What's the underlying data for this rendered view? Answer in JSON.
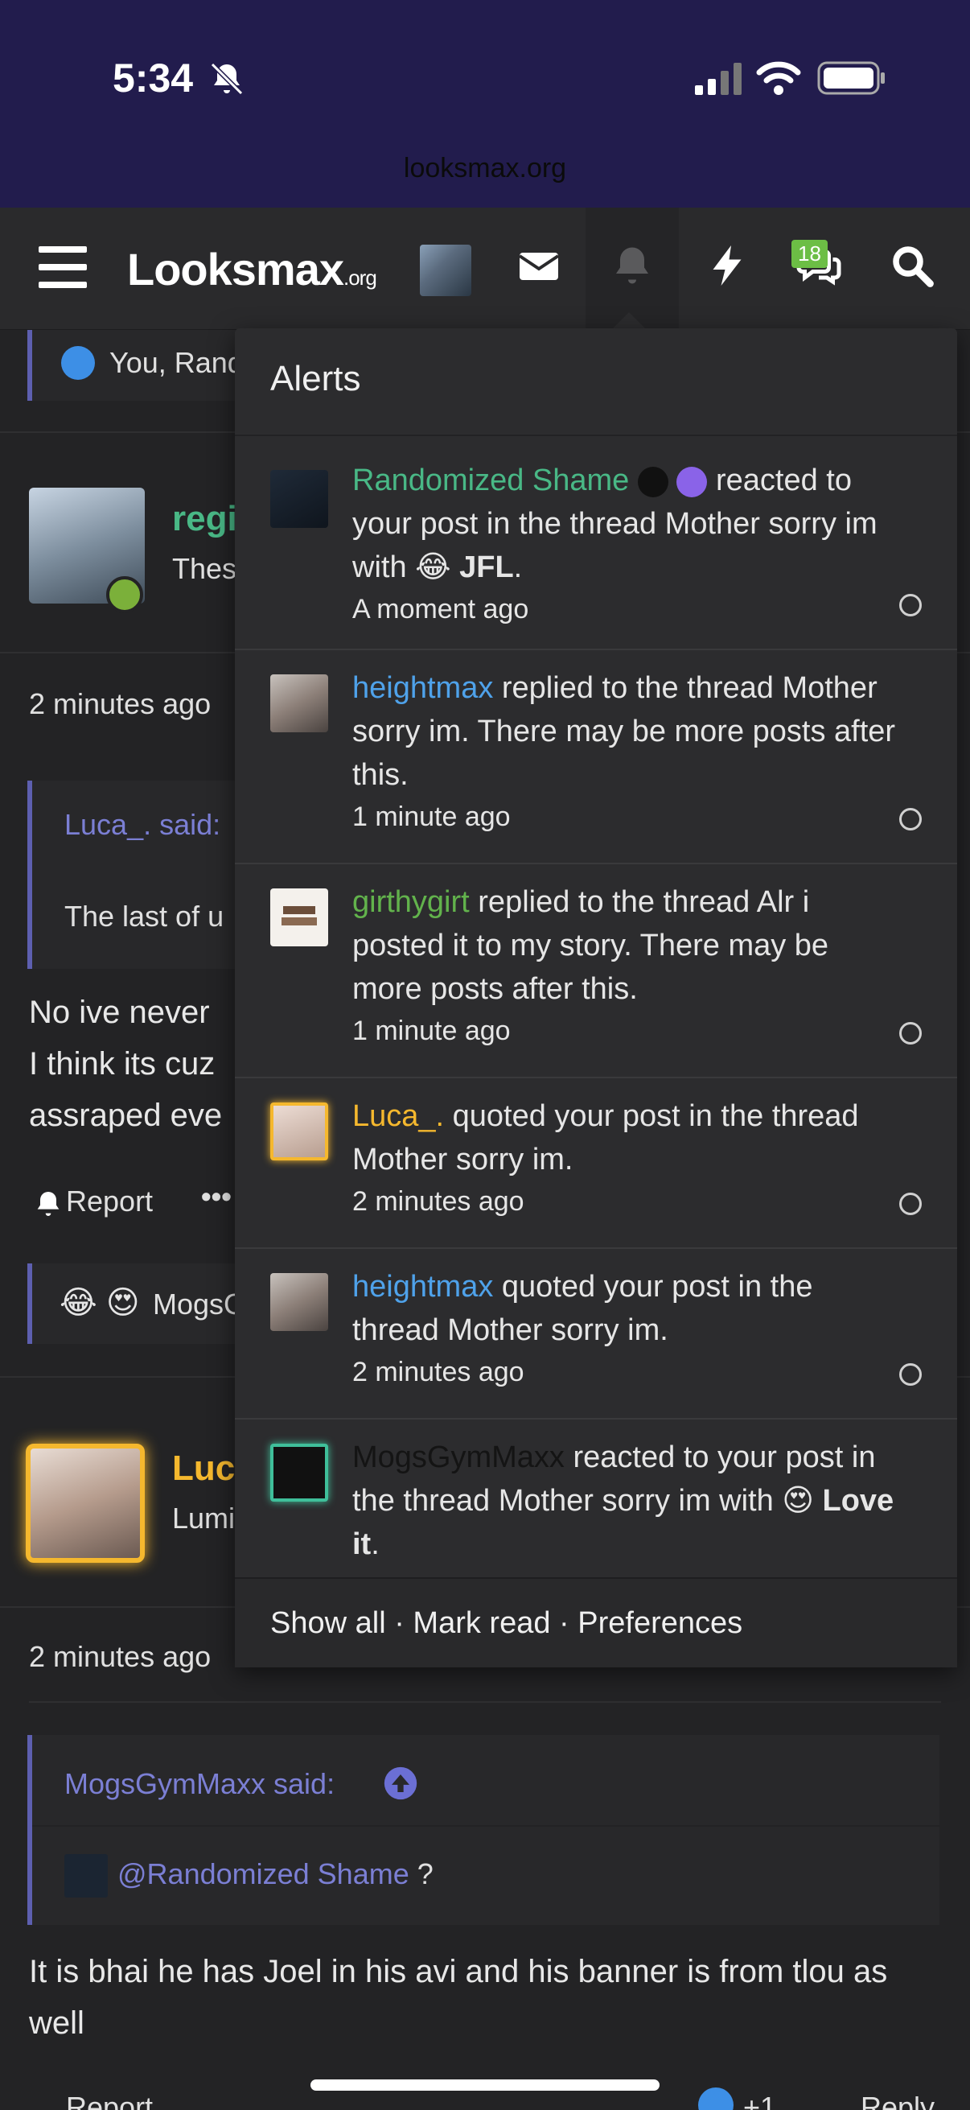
{
  "status_bar": {
    "time": "5:34",
    "url": "looksmax.org"
  },
  "header": {
    "logo_main": "Looksmax",
    "logo_suffix": ".org",
    "notification_badge": "18",
    "icons": [
      "menu-icon",
      "mail-icon",
      "bell-icon",
      "bolt-icon",
      "chat-icon",
      "search-icon"
    ]
  },
  "background": {
    "reaction_row_1": "You, Rand",
    "post_user": "regi",
    "post_subtitle": "Thes",
    "post_time_1": "2 minutes ago",
    "quote_author_1": "Luca_. said:",
    "quote_text_1": "The last of u",
    "post_body_1": "No ive never",
    "post_body_2": "I think its cuz",
    "post_body_3": "assraped eve",
    "report_label": "Report",
    "more_label": "•••",
    "reaction_row_2": "MogsG",
    "post2_user": "Luc",
    "post2_subtitle": "Lumi",
    "post_time_2": "2 minutes ago",
    "quote_author_2": "MogsGymMaxx said:",
    "quote_mention": "@Randomized Shame",
    "quote_mention_suffix": " ?",
    "post2_body": "It is bhai he has Joel in his avi and his banner is from tlou as well",
    "report_label_2": "Report",
    "reply_label": "Reply",
    "like_count": "+1"
  },
  "alerts": {
    "title": "Alerts",
    "items": [
      {
        "user": "Randomized Shame",
        "text": " reacted to your post in the thread Mother sorry im with ",
        "reaction": "😂 JFL",
        "end": ".",
        "time": "A moment ago"
      },
      {
        "user": "heightmax",
        "text": " replied to the thread Mother sorry im. There may be more posts after this.",
        "time": "1 minute ago"
      },
      {
        "user": "girthygirt",
        "text": " replied to the thread Alr i posted it to my story. There may be more posts after this.",
        "time": "1 minute ago"
      },
      {
        "user": "Luca_.",
        "text": " quoted your post in the thread Mother sorry im.",
        "time": "2 minutes ago"
      },
      {
        "user": "heightmax",
        "text": " quoted your post in the thread Mother sorry im.",
        "time": "2 minutes ago"
      },
      {
        "user": "MogsGymMaxx",
        "text": " reacted to your post in the thread Mother sorry im with ",
        "reaction": "😍 Love it",
        "end": "."
      }
    ],
    "footer": {
      "show_all": "Show all",
      "sep": " · ",
      "mark_read": "Mark read",
      "preferences": "Preferences"
    }
  },
  "colors": {
    "accent": "#5d5fb0",
    "header_bg": "#2a2a2c",
    "status_bg": "#221c4d"
  }
}
